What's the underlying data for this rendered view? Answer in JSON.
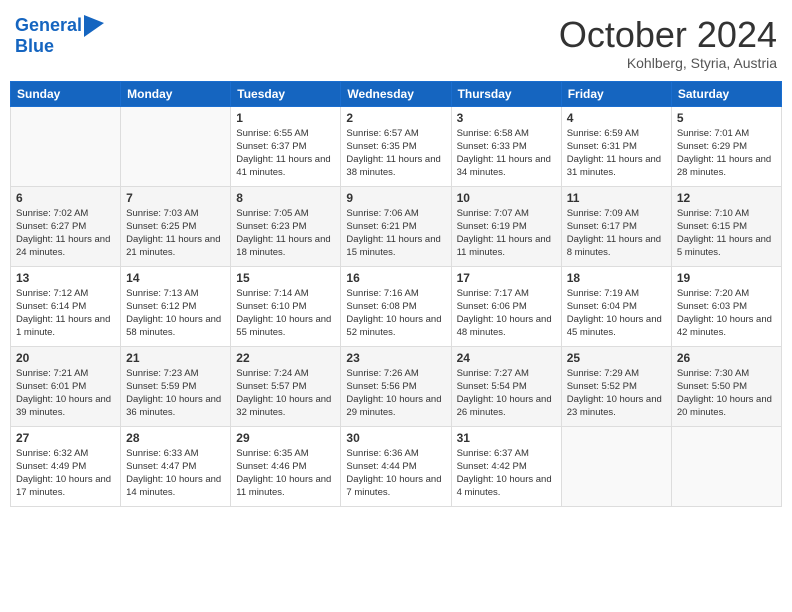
{
  "header": {
    "logo_line1": "General",
    "logo_line2": "Blue",
    "month_title": "October 2024",
    "subtitle": "Kohlberg, Styria, Austria"
  },
  "weekdays": [
    "Sunday",
    "Monday",
    "Tuesday",
    "Wednesday",
    "Thursday",
    "Friday",
    "Saturday"
  ],
  "weeks": [
    [
      {
        "day": "",
        "info": ""
      },
      {
        "day": "",
        "info": ""
      },
      {
        "day": "1",
        "info": "Sunrise: 6:55 AM\nSunset: 6:37 PM\nDaylight: 11 hours and 41 minutes."
      },
      {
        "day": "2",
        "info": "Sunrise: 6:57 AM\nSunset: 6:35 PM\nDaylight: 11 hours and 38 minutes."
      },
      {
        "day": "3",
        "info": "Sunrise: 6:58 AM\nSunset: 6:33 PM\nDaylight: 11 hours and 34 minutes."
      },
      {
        "day": "4",
        "info": "Sunrise: 6:59 AM\nSunset: 6:31 PM\nDaylight: 11 hours and 31 minutes."
      },
      {
        "day": "5",
        "info": "Sunrise: 7:01 AM\nSunset: 6:29 PM\nDaylight: 11 hours and 28 minutes."
      }
    ],
    [
      {
        "day": "6",
        "info": "Sunrise: 7:02 AM\nSunset: 6:27 PM\nDaylight: 11 hours and 24 minutes."
      },
      {
        "day": "7",
        "info": "Sunrise: 7:03 AM\nSunset: 6:25 PM\nDaylight: 11 hours and 21 minutes."
      },
      {
        "day": "8",
        "info": "Sunrise: 7:05 AM\nSunset: 6:23 PM\nDaylight: 11 hours and 18 minutes."
      },
      {
        "day": "9",
        "info": "Sunrise: 7:06 AM\nSunset: 6:21 PM\nDaylight: 11 hours and 15 minutes."
      },
      {
        "day": "10",
        "info": "Sunrise: 7:07 AM\nSunset: 6:19 PM\nDaylight: 11 hours and 11 minutes."
      },
      {
        "day": "11",
        "info": "Sunrise: 7:09 AM\nSunset: 6:17 PM\nDaylight: 11 hours and 8 minutes."
      },
      {
        "day": "12",
        "info": "Sunrise: 7:10 AM\nSunset: 6:15 PM\nDaylight: 11 hours and 5 minutes."
      }
    ],
    [
      {
        "day": "13",
        "info": "Sunrise: 7:12 AM\nSunset: 6:14 PM\nDaylight: 11 hours and 1 minute."
      },
      {
        "day": "14",
        "info": "Sunrise: 7:13 AM\nSunset: 6:12 PM\nDaylight: 10 hours and 58 minutes."
      },
      {
        "day": "15",
        "info": "Sunrise: 7:14 AM\nSunset: 6:10 PM\nDaylight: 10 hours and 55 minutes."
      },
      {
        "day": "16",
        "info": "Sunrise: 7:16 AM\nSunset: 6:08 PM\nDaylight: 10 hours and 52 minutes."
      },
      {
        "day": "17",
        "info": "Sunrise: 7:17 AM\nSunset: 6:06 PM\nDaylight: 10 hours and 48 minutes."
      },
      {
        "day": "18",
        "info": "Sunrise: 7:19 AM\nSunset: 6:04 PM\nDaylight: 10 hours and 45 minutes."
      },
      {
        "day": "19",
        "info": "Sunrise: 7:20 AM\nSunset: 6:03 PM\nDaylight: 10 hours and 42 minutes."
      }
    ],
    [
      {
        "day": "20",
        "info": "Sunrise: 7:21 AM\nSunset: 6:01 PM\nDaylight: 10 hours and 39 minutes."
      },
      {
        "day": "21",
        "info": "Sunrise: 7:23 AM\nSunset: 5:59 PM\nDaylight: 10 hours and 36 minutes."
      },
      {
        "day": "22",
        "info": "Sunrise: 7:24 AM\nSunset: 5:57 PM\nDaylight: 10 hours and 32 minutes."
      },
      {
        "day": "23",
        "info": "Sunrise: 7:26 AM\nSunset: 5:56 PM\nDaylight: 10 hours and 29 minutes."
      },
      {
        "day": "24",
        "info": "Sunrise: 7:27 AM\nSunset: 5:54 PM\nDaylight: 10 hours and 26 minutes."
      },
      {
        "day": "25",
        "info": "Sunrise: 7:29 AM\nSunset: 5:52 PM\nDaylight: 10 hours and 23 minutes."
      },
      {
        "day": "26",
        "info": "Sunrise: 7:30 AM\nSunset: 5:50 PM\nDaylight: 10 hours and 20 minutes."
      }
    ],
    [
      {
        "day": "27",
        "info": "Sunrise: 6:32 AM\nSunset: 4:49 PM\nDaylight: 10 hours and 17 minutes."
      },
      {
        "day": "28",
        "info": "Sunrise: 6:33 AM\nSunset: 4:47 PM\nDaylight: 10 hours and 14 minutes."
      },
      {
        "day": "29",
        "info": "Sunrise: 6:35 AM\nSunset: 4:46 PM\nDaylight: 10 hours and 11 minutes."
      },
      {
        "day": "30",
        "info": "Sunrise: 6:36 AM\nSunset: 4:44 PM\nDaylight: 10 hours and 7 minutes."
      },
      {
        "day": "31",
        "info": "Sunrise: 6:37 AM\nSunset: 4:42 PM\nDaylight: 10 hours and 4 minutes."
      },
      {
        "day": "",
        "info": ""
      },
      {
        "day": "",
        "info": ""
      }
    ]
  ]
}
